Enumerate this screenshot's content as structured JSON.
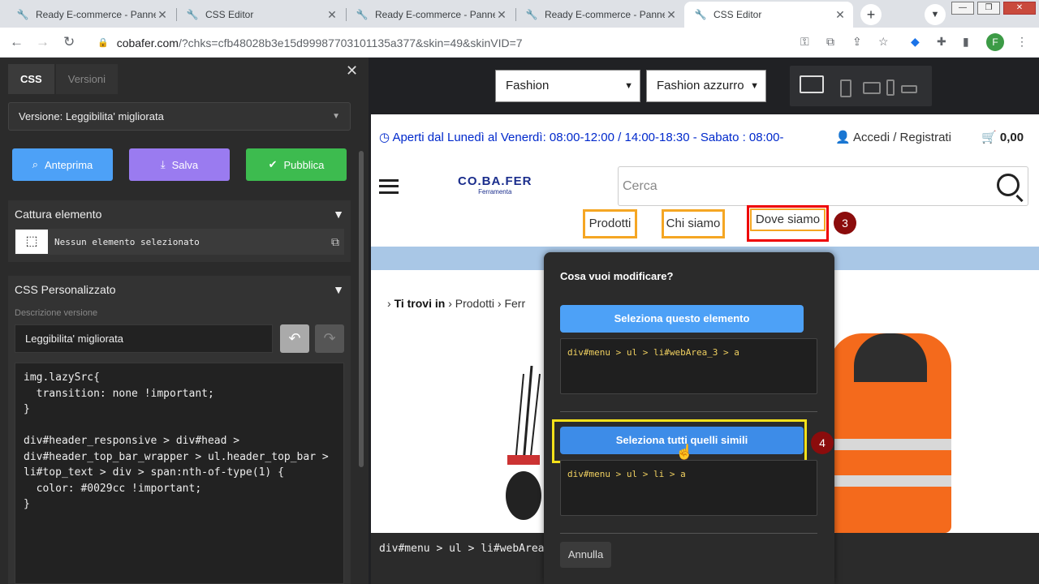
{
  "browser": {
    "tabs": [
      {
        "title": "Ready E-commerce - Panne"
      },
      {
        "title": "CSS Editor"
      },
      {
        "title": "Ready E-commerce - Panne"
      },
      {
        "title": "Ready E-commerce - Panne"
      },
      {
        "title": "CSS Editor"
      }
    ],
    "url_host": "cobafer.com",
    "url_path": "/?chks=cfb48028b3e15d99987703101135a377&skin=49&skinVID=7",
    "profile_initial": "F"
  },
  "editor": {
    "tab_css": "CSS",
    "tab_versions": "Versioni",
    "version_select": "Versione: Leggibilita' migliorata",
    "btn_preview": "Anteprima",
    "btn_save": "Salva",
    "btn_publish": "Pubblica",
    "capture_title": "Cattura elemento",
    "capture_status": "Nessun elemento selezionato",
    "custom_css_title": "CSS Personalizzato",
    "desc_label": "Descrizione versione",
    "desc_value": "Leggibilita' migliorata",
    "code": "img.lazySrc{\n  transition: none !important;\n}\n\ndiv#header_responsive > div#head >\ndiv#header_top_bar_wrapper > ul.header_top_bar >\nli#top_text > div > span:nth-of-type(1) {\n  color: #0029cc !important;\n}"
  },
  "preview_bar": {
    "theme_select": "Fashion",
    "color_select": "Fashion azzurro"
  },
  "site": {
    "top_info": "Aperti dal Lunedì al Venerdì: 08:00-12:00 / 14:00-18:30 - Sabato : 08:00-",
    "account": "Accedi / Registrati",
    "cart_total": "0,00",
    "logo_main": "CO.BA.FER",
    "logo_sub": "Ferramenta",
    "search_placeholder": "Cerca",
    "menu": [
      "Prodotti",
      "Chi siamo",
      "Dove siamo"
    ],
    "breadcrumb_label": "Ti trovi in",
    "breadcrumb_item1": "Prodotti",
    "breadcrumb_item2": "Ferr"
  },
  "steps": {
    "step3": "3",
    "step4": "4"
  },
  "modal": {
    "title": "Cosa vuoi modificare?",
    "btn_select_this": "Seleziona questo elemento",
    "selector_this": "div#menu > ul > li#webArea_3 > a",
    "btn_select_similar": "Seleziona tutti quelli simili",
    "selector_similar": "div#menu > ul > li > a",
    "btn_cancel": "Annulla"
  },
  "bottom_selector": "div#menu > ul > li#webArea",
  "colors": {
    "blue_button": "#4da1f7",
    "save_button": "#9a7bf0",
    "publish_button": "#3dbb4f",
    "highlight_orange": "#f5a623",
    "highlight_red": "#e00000",
    "highlight_yellow": "#f5e11a"
  }
}
